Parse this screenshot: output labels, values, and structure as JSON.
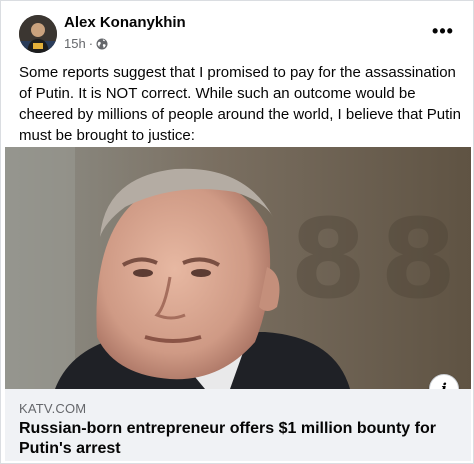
{
  "post": {
    "author": "Alex Konanykhin",
    "time": "15h",
    "separator": "·",
    "audience_icon": "globe-icon",
    "more_icon": "more-options-icon",
    "more_label": "•••",
    "text": "Some reports suggest that I promised to pay for the assassination of Putin. It is NOT correct. While such an outcome would be cheered by millions of people around the world, I believe that Putin must be brought to justice:"
  },
  "link_preview": {
    "domain": "KATV.COM",
    "title": "Russian-born entrepreneur offers $1 million bounty for Putin's arrest",
    "info_icon": "info-icon",
    "info_label": "i"
  },
  "colors": {
    "text_primary": "#050505",
    "text_secondary": "#65676b",
    "link_background": "#f0f2f5"
  }
}
